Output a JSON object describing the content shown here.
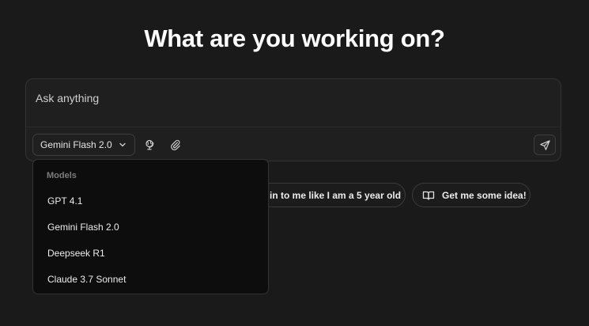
{
  "heading": "What are you working on?",
  "composer": {
    "placeholder": "Ask anything",
    "selected_model": "Gemini Flash 2.0"
  },
  "suggestions": [
    {
      "label": "in to me like I am a 5 year old"
    },
    {
      "label": "Get me some idea!",
      "icon": "book-open-icon"
    }
  ],
  "dropdown": {
    "title": "Models",
    "items": [
      {
        "label": "GPT 4.1"
      },
      {
        "label": "Gemini Flash 2.0"
      },
      {
        "label": "Deepseek R1"
      },
      {
        "label": "Claude 3.7 Sonnet"
      }
    ]
  },
  "icons": {
    "model_chevron": "chevron-down-icon",
    "web": "globe-icon",
    "attach": "paperclip-icon",
    "send": "send-icon"
  },
  "colors": {
    "background": "#1a1a1a",
    "composer": "#1f1f1f",
    "dropdown": "#0d0d0d",
    "border": "#333333",
    "text": "#ffffff",
    "muted": "#7d7d7d"
  }
}
